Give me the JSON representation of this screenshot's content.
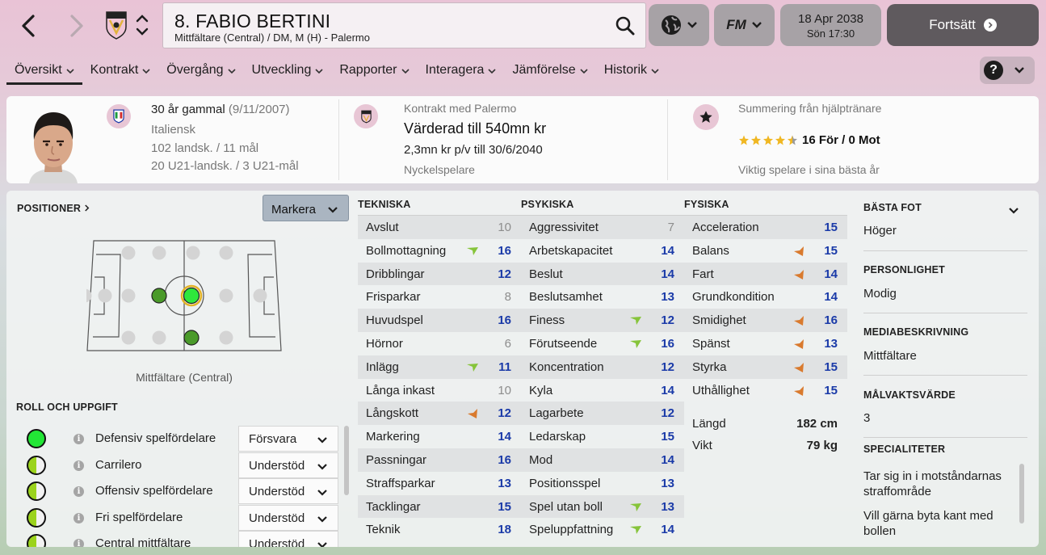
{
  "header": {
    "player_title": "8. FABIO BERTINI",
    "player_subtitle": "Mittfältare (Central) / DM, M (H) - Palermo",
    "date": "18 Apr 2038",
    "day_time": "Sön 17:30",
    "continue_label": "Fortsätt",
    "fm_label": "FM"
  },
  "tabs": [
    "Översikt",
    "Kontrakt",
    "Övergång",
    "Utveckling",
    "Rapporter",
    "Interagera",
    "Jämförelse",
    "Historik"
  ],
  "info": {
    "age_line": "30 år gammal",
    "birth_date": "(9/11/2007)",
    "nationality": "Italiensk",
    "caps": "102 landsk. / 11 mål",
    "u21_caps": "20 U21-landsk. / 3 U21-mål",
    "contract_title": "Kontrakt med Palermo",
    "value": "Värderad till 540mn kr",
    "wage": "2,3mn kr p/v till 30/6/2040",
    "squad_status": "Nyckelspelare",
    "assistant_title": "Summering från hjälptränare",
    "assistant_rating_stars": 4.5,
    "assistant_votes": "16 För / 0 Mot",
    "assistant_summary": "Viktig spelare i sina bästa år"
  },
  "positions": {
    "title": "POSITIONER",
    "dropdown": "Markera",
    "label": "Mittfältare (Central)"
  },
  "roles": {
    "title": "ROLL OCH UPPGIFT",
    "items": [
      {
        "name": "Defensiv spelfördelare",
        "duty": "Försvara",
        "fill": "full"
      },
      {
        "name": "Carrilero",
        "duty": "Understöd",
        "fill": "half"
      },
      {
        "name": "Offensiv spelfördelare",
        "duty": "Understöd",
        "fill": "half"
      },
      {
        "name": "Fri spelfördelare",
        "duty": "Understöd",
        "fill": "half"
      },
      {
        "name": "Central mittfältare",
        "duty": "Understöd",
        "fill": "half"
      }
    ]
  },
  "technical": {
    "title": "TEKNISKA",
    "items": [
      {
        "name": "Avslut",
        "value": "10",
        "trend": ""
      },
      {
        "name": "Bollmottagning",
        "value": "16",
        "trend": "up"
      },
      {
        "name": "Dribblingar",
        "value": "12",
        "trend": ""
      },
      {
        "name": "Frisparkar",
        "value": "8",
        "trend": ""
      },
      {
        "name": "Huvudspel",
        "value": "16",
        "trend": ""
      },
      {
        "name": "Hörnor",
        "value": "6",
        "trend": ""
      },
      {
        "name": "Inlägg",
        "value": "11",
        "trend": "up"
      },
      {
        "name": "Långa inkast",
        "value": "10",
        "trend": ""
      },
      {
        "name": "Långskott",
        "value": "12",
        "trend": "down"
      },
      {
        "name": "Markering",
        "value": "14",
        "trend": ""
      },
      {
        "name": "Passningar",
        "value": "16",
        "trend": ""
      },
      {
        "name": "Straffsparkar",
        "value": "13",
        "trend": ""
      },
      {
        "name": "Tacklingar",
        "value": "15",
        "trend": ""
      },
      {
        "name": "Teknik",
        "value": "18",
        "trend": ""
      }
    ]
  },
  "mental": {
    "title": "PSYKISKA",
    "items": [
      {
        "name": "Aggressivitet",
        "value": "7",
        "trend": ""
      },
      {
        "name": "Arbetskapacitet",
        "value": "14",
        "trend": ""
      },
      {
        "name": "Beslut",
        "value": "14",
        "trend": ""
      },
      {
        "name": "Beslutsamhet",
        "value": "13",
        "trend": ""
      },
      {
        "name": "Finess",
        "value": "12",
        "trend": "up"
      },
      {
        "name": "Förutseende",
        "value": "16",
        "trend": "up"
      },
      {
        "name": "Koncentration",
        "value": "12",
        "trend": ""
      },
      {
        "name": "Kyla",
        "value": "14",
        "trend": ""
      },
      {
        "name": "Lagarbete",
        "value": "12",
        "trend": ""
      },
      {
        "name": "Ledarskap",
        "value": "15",
        "trend": ""
      },
      {
        "name": "Mod",
        "value": "14",
        "trend": ""
      },
      {
        "name": "Positionsspel",
        "value": "13",
        "trend": ""
      },
      {
        "name": "Spel utan boll",
        "value": "13",
        "trend": "up"
      },
      {
        "name": "Speluppfattning",
        "value": "14",
        "trend": "up"
      }
    ]
  },
  "physical": {
    "title": "FYSISKA",
    "items": [
      {
        "name": "Acceleration",
        "value": "15",
        "trend": ""
      },
      {
        "name": "Balans",
        "value": "15",
        "trend": "down"
      },
      {
        "name": "Fart",
        "value": "14",
        "trend": "down"
      },
      {
        "name": "Grundkondition",
        "value": "14",
        "trend": ""
      },
      {
        "name": "Smidighet",
        "value": "16",
        "trend": "down"
      },
      {
        "name": "Spänst",
        "value": "13",
        "trend": "down"
      },
      {
        "name": "Styrka",
        "value": "15",
        "trend": "down"
      },
      {
        "name": "Uthållighet",
        "value": "15",
        "trend": "down"
      }
    ],
    "height_label": "Längd",
    "height_value": "182 cm",
    "weight_label": "Vikt",
    "weight_value": "79 kg"
  },
  "right_panel": {
    "best_foot_title": "BÄSTA FOT",
    "best_foot": "Höger",
    "personality_title": "PERSONLIGHET",
    "personality": "Modig",
    "media_title": "MEDIABESKRIVNING",
    "media": "Mittfältare",
    "gk_title": "MÅLVAKTSVÄRDE",
    "gk": "3",
    "spec_title": "SPECIALITETER",
    "specialities": [
      "Tar sig in i motståndarnas straffområde",
      "Vill gärna byta kant med bollen"
    ]
  },
  "colors": {
    "attr_blue": "#1a3aa8",
    "trend_up": "#86c43a",
    "trend_down": "#d97a2e",
    "role_green": "#22e636",
    "role_half": "#9bd31c"
  }
}
